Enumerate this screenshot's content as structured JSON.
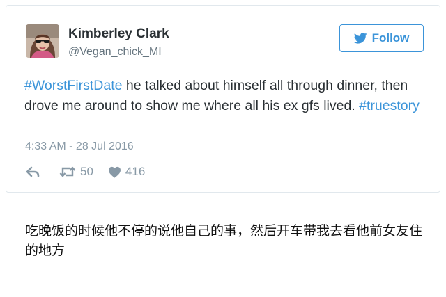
{
  "tweet": {
    "author": {
      "display_name": "Kimberley Clark",
      "handle": "@Vegan_chick_MI",
      "avatar_icon": "profile-photo"
    },
    "follow_button": {
      "label": "Follow",
      "icon": "twitter-bird-icon",
      "color": "#3b94d9"
    },
    "text": {
      "hashtag_1": "#WorstFirstDate",
      "body": " he talked about himself all through dinner, then drove me around to show me where all his ex gfs lived. ",
      "hashtag_2": "#truestory"
    },
    "timestamp": "4:33 AM - 28 Jul 2016",
    "actions": {
      "reply_icon": "reply-icon",
      "retweet_icon": "retweet-icon",
      "retweet_count": "50",
      "like_icon": "heart-icon",
      "like_count": "416"
    }
  },
  "translation": "吃晚饭的时候他不停的说他自己的事，然后开车带我去看他前女友住的地方",
  "colors": {
    "link": "#3b94d9",
    "text": "#292f33",
    "muted": "#8899a6",
    "border": "#e1e8ed"
  }
}
